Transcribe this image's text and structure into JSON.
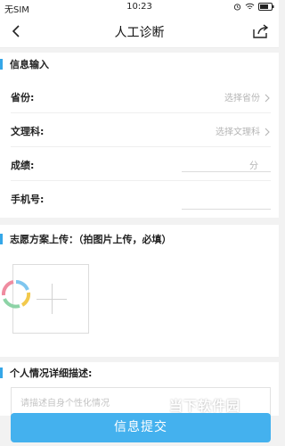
{
  "status_bar": {
    "carrier": "无SIM",
    "time": "10:23"
  },
  "nav": {
    "title": "人工诊断"
  },
  "info_section": {
    "title": "信息输入",
    "rows": [
      {
        "label": "省份:",
        "value": "选择省份"
      },
      {
        "label": "文理科:",
        "value": "选择文理科"
      },
      {
        "label": "成绩:",
        "unit": "分"
      },
      {
        "label": "手机号:"
      }
    ]
  },
  "upload_section": {
    "title": "志愿方案上传：（拍图片上传，必填）"
  },
  "desc_section": {
    "title": "个人情况详细描述:",
    "placeholder": "请描述自身个性化情况"
  },
  "submit_label": "信息提交",
  "watermark": {
    "text": "当下软件园"
  },
  "colors": {
    "accent": "#35a7e8",
    "button": "#44b1ee"
  }
}
